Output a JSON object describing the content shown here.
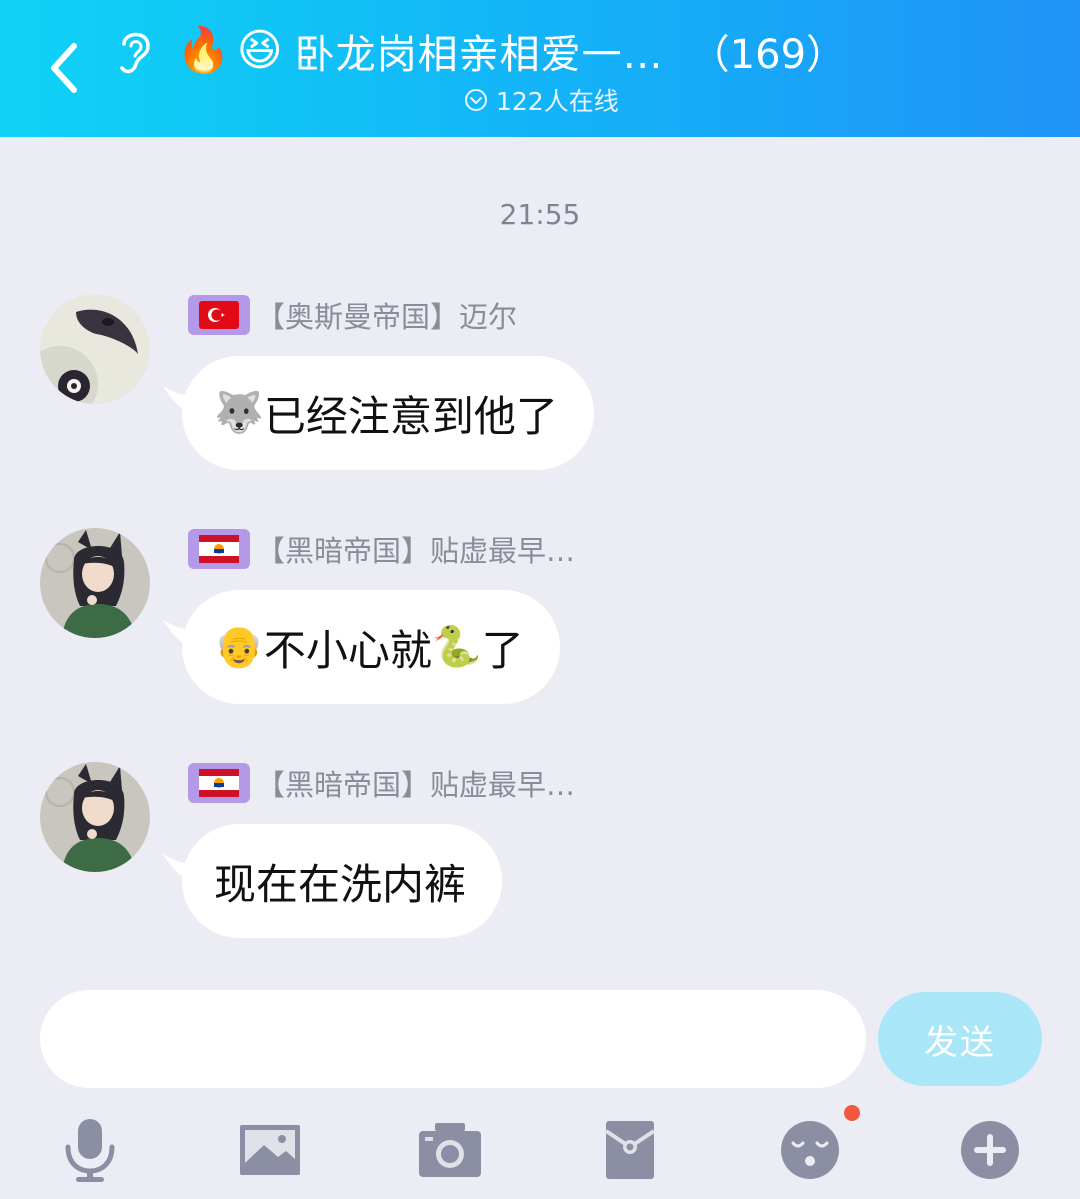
{
  "header": {
    "title_emojis": [
      "🔥",
      "😆"
    ],
    "title": "卧龙岗相亲相爱一…",
    "member_count": "（169）",
    "online": "122人在线"
  },
  "timestamp": "21:55",
  "messages": [
    {
      "sender": "【奥斯曼帝国】迈尔",
      "flag": "turkey-flag",
      "emoji_before": "🐺",
      "text": "已经注意到他了",
      "emoji_after": ""
    },
    {
      "sender": "【黑暗帝国】贴虚最早…",
      "flag": "french-polynesia-flag",
      "emoji_before": "👴",
      "text": "不小心就",
      "emoji_after": "🐍",
      "text_after": "了"
    },
    {
      "sender": "【黑暗帝国】贴虚最早…",
      "flag": "french-polynesia-flag",
      "emoji_before": "",
      "text": "现在在洗内裤",
      "emoji_after": ""
    }
  ],
  "composer": {
    "placeholder": "",
    "send_label": "发送"
  },
  "toolbar": [
    "microphone-icon",
    "image-icon",
    "camera-icon",
    "red-envelope-icon",
    "emoji-icon",
    "plus-icon"
  ],
  "colors": {
    "header_start": "#0fd3f6",
    "header_end": "#1f93f7",
    "background": "#ecedf4",
    "bubble": "#ffffff",
    "send_button": "#a9e6f8",
    "badge": "#b399e8",
    "toolbar_icon": "#8c8fa3",
    "notification_dot": "#f2563c"
  }
}
